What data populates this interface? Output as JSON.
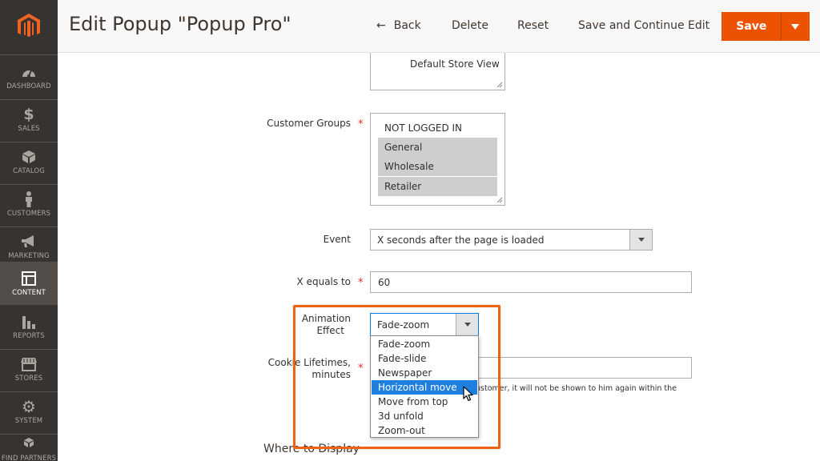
{
  "colors": {
    "accent": "#eb5202",
    "sidebar": "#373330",
    "highlight": "#ec6413",
    "selection": "#1e7fde"
  },
  "header": {
    "title": "Edit Popup \"Popup Pro\"",
    "back_label": "Back",
    "delete_label": "Delete",
    "reset_label": "Reset",
    "save_continue_label": "Save and Continue Edit",
    "save_label": "Save"
  },
  "sidebar": {
    "items": [
      {
        "label": "DASHBOARD",
        "icon": "dashboard-icon"
      },
      {
        "label": "SALES",
        "icon": "dollar-icon"
      },
      {
        "label": "CATALOG",
        "icon": "box-icon"
      },
      {
        "label": "CUSTOMERS",
        "icon": "person-icon"
      },
      {
        "label": "MARKETING",
        "icon": "megaphone-icon"
      },
      {
        "label": "CONTENT",
        "icon": "layout-icon"
      },
      {
        "label": "REPORTS",
        "icon": "bar-chart-icon"
      },
      {
        "label": "STORES",
        "icon": "store-icon"
      },
      {
        "label": "SYSTEM",
        "icon": "gear-icon"
      },
      {
        "label": "FIND PARTNERS",
        "icon": "cubes-icon"
      }
    ]
  },
  "form": {
    "store_view_option": "Default Store View",
    "customer_groups": {
      "label": "Customer Groups",
      "options": [
        "NOT LOGGED IN",
        "General",
        "Wholesale",
        "Retailer"
      ]
    },
    "event": {
      "label": "Event",
      "value": "X seconds after the page is loaded"
    },
    "x_equals": {
      "label": "X equals to",
      "value": "60"
    },
    "animation": {
      "label_line1": "Animation",
      "label_line2": "Effect",
      "value": "Fade-zoom",
      "options": [
        "Fade-zoom",
        "Fade-slide",
        "Newspaper",
        "Horizontal move",
        "Move from top",
        "3d unfold",
        "Zoom-out"
      ],
      "highlighted": "Horizontal move"
    },
    "cookie": {
      "label_line1": "Cookie Lifetimes,",
      "label_line2": "minutes",
      "note": "ustomer, it will not be shown to him again within the"
    },
    "where_to_display": "Where to Display"
  }
}
